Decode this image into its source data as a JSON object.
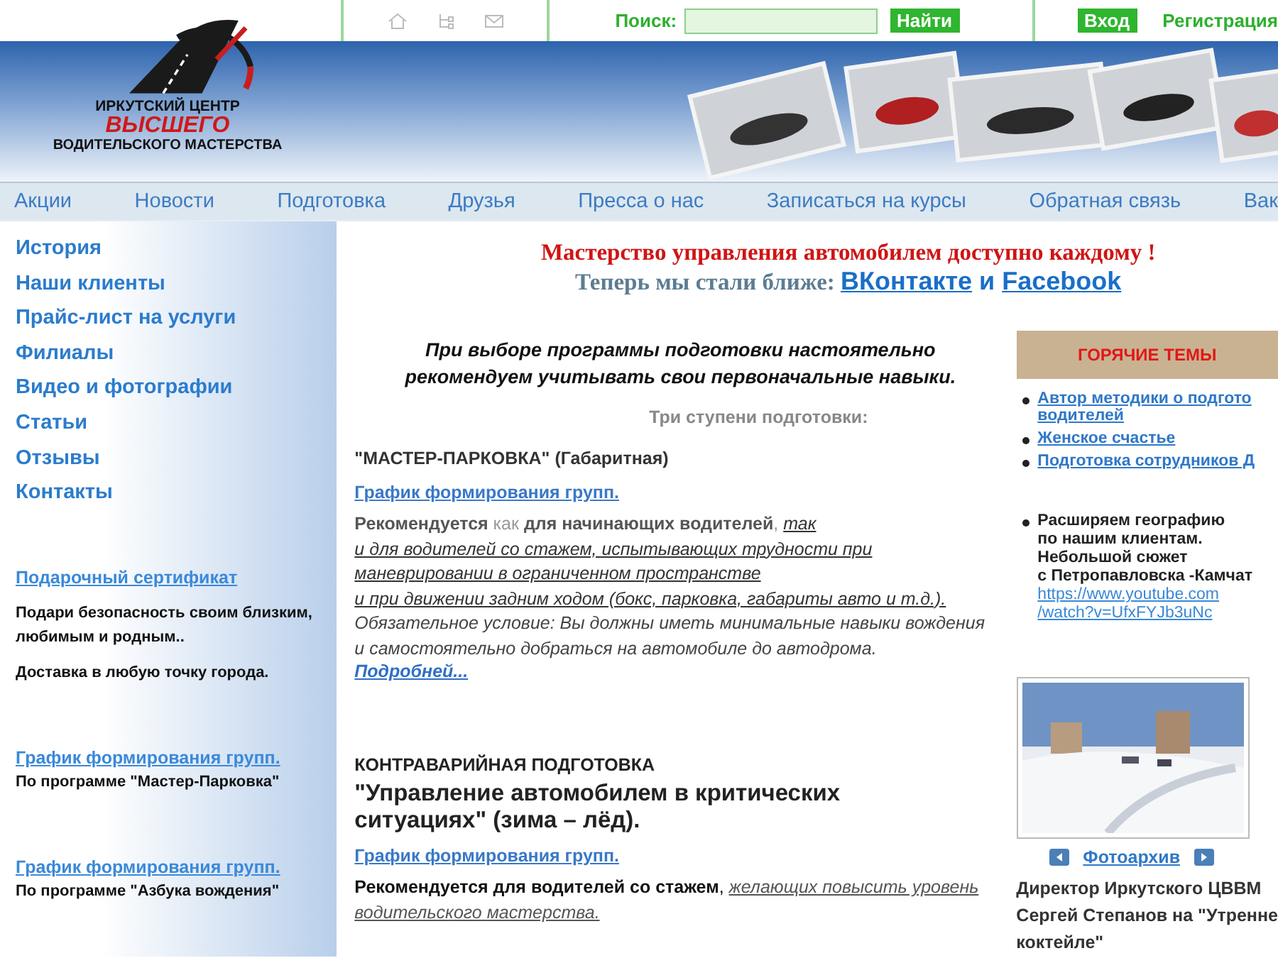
{
  "top_bar": {
    "search": {
      "label": "Поиск:",
      "button": "Найти"
    },
    "login": "Вход",
    "register": "Регистрация"
  },
  "logo": {
    "line1": "ИРКУТСКИЙ ЦЕНТР",
    "line2": "ВЫСШЕГО",
    "line3": "ВОДИТЕЛЬСКОГО МАСТЕРСТВА"
  },
  "nav": [
    "Акции",
    "Новости",
    "Подготовка",
    "Друзья",
    "Пресса о нас",
    "Записаться на курсы",
    "Обратная связь",
    "Вак"
  ],
  "sidebar": {
    "links": [
      "История",
      "Наши клиенты",
      "Прайс-лист на услуги",
      "Филиалы",
      "Видео и фотографии",
      "Статьи",
      "Отзывы",
      "Контакты"
    ],
    "certificate": {
      "link": "Подарочный сертификат",
      "texts": [
        "Подари безопасность своим близким, любимым и родным..",
        "Доставка в любую точку города."
      ]
    },
    "schedules": [
      {
        "link": "График формирования групп.",
        "program": "По программе \"Мастер-Парковка\""
      },
      {
        "link": "График формирования групп.",
        "program": "По программе \"Азбука вождения\""
      }
    ]
  },
  "main": {
    "headline": "Мастерство управления автомобилем доступно каждому !",
    "social": {
      "text": "Теперь мы стали ближе:",
      "links": [
        "ВКонтакте",
        "Facebook"
      ],
      "joiner": "и"
    },
    "intro": "При выборе программы подготовки настоятельно\nрекомендуем учитывать свои первоначальные навыки.",
    "steps_title": "Три ступени подготовки:",
    "programs": [
      {
        "kind": "basic",
        "title": "\"МАСТЕР-ПАРКОВКА\" (Габаритная)",
        "schedule_link": "График формирования групп.",
        "description": " **Рекомендуется** как **для начинающих водителей**, *так\nи для водителей со стажем, испытывающих трудности при\nманеврировании в ограниченном пространстве\n и при движении задним ходом (бокс, парковка, габариты авто и т.д.).*",
        "condition": "Обязательное условие: Вы должны иметь минимальные навыки вождения\n и самостоятельно добраться на автомобиле до автодрома.",
        "more_link": "Подробней..."
      },
      {
        "kind": "featured",
        "category": "КОНТРАВАРИЙНАЯ ПОДГОТОВКА",
        "title": "\"Управление автомобилем в критических\nситуациях\" (зима – лёд).",
        "schedule_link": "График формирования групп.",
        "description": "**Рекомендуется для водителей со стажем**, *желающих повысить уровень\nводительского мастерства.*"
      }
    ]
  },
  "hot_topics": {
    "title": "ГОРЯЧИЕ ТЕМЫ",
    "links": [
      "Автор методики о подгото\nводителей",
      "Женское счастье",
      "Подготовка сотрудников Д"
    ],
    "news": {
      "text": "Расширяем географию\nпо нашим клиентам.\nНебольшой сюжет\nс Петропавловска -Камчат",
      "url": "https://www.youtube.com\n/watch?v=UfxFYJb3uNc"
    },
    "photo_archive": "Фотоархив",
    "caption": "Директор Иркутского ЦВВМ\nСергей Степанов на \"Утренне\nкоктейле\""
  }
}
